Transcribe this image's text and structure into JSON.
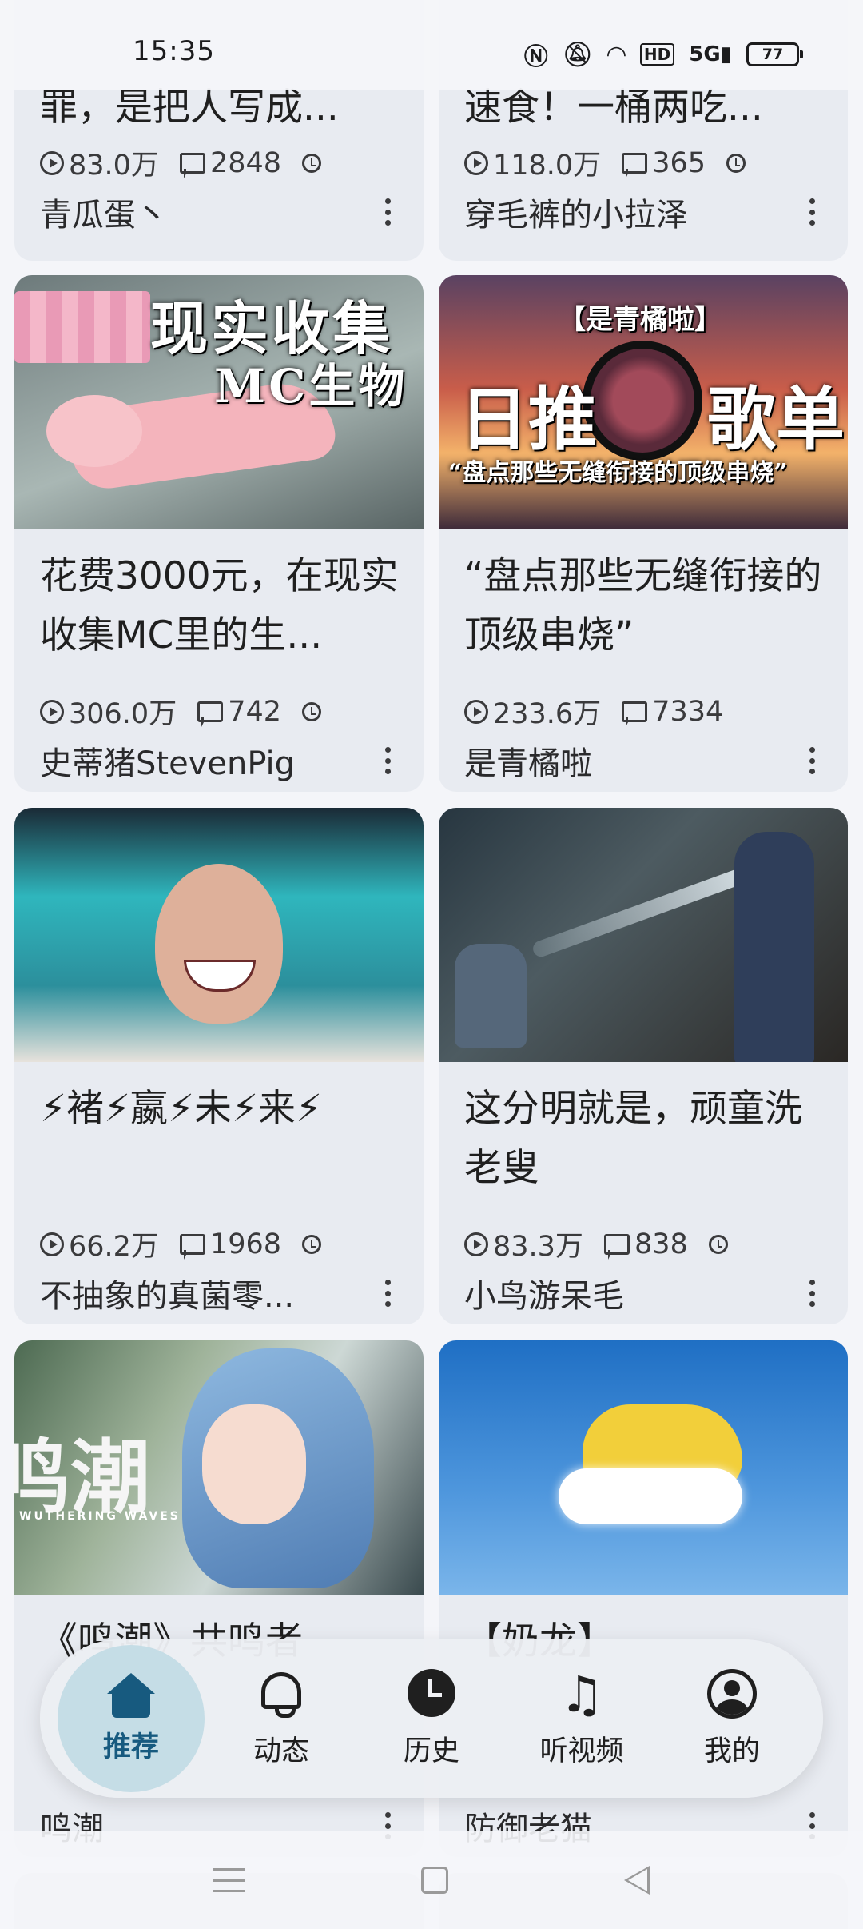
{
  "status_bar": {
    "time": "15:35",
    "icons": [
      "nfc-icon",
      "mute-icon",
      "wifi-icon",
      "hd-icon",
      "5g-signal-icon"
    ],
    "battery": "77"
  },
  "feed": {
    "cards": [
      {
        "title": "罪，是把人写成...",
        "views": "83.0万",
        "comments": "2848",
        "author": "青瓜蛋丶"
      },
      {
        "title": "速食！一桶两吃...",
        "views": "118.0万",
        "comments": "365",
        "author": "穿毛裤的小拉泽"
      },
      {
        "thumb_text": [
          "现实收集",
          "MC生物"
        ],
        "title": "花费3000元，在现实收集MC里的生...",
        "views": "306.0万",
        "comments": "742",
        "author": "史蒂猪StevenPig"
      },
      {
        "thumb_text": [
          "【是青橘啦】",
          "日推",
          "歌单",
          "“盘点那些无缝衔接的顶级串烧”"
        ],
        "title": "“盘点那些无缝衔接的顶级串烧”",
        "views": "233.6万",
        "comments": "7334",
        "author": "是青橘啦"
      },
      {
        "title": "⚡褚⚡嬴⚡未⚡来⚡",
        "views": "66.2万",
        "comments": "1968",
        "author": "不抽象的真菌零..."
      },
      {
        "title": "这分明就是，顽童洗老叟",
        "views": "83.3万",
        "comments": "838",
        "author": "小鸟游呆毛"
      },
      {
        "thumb_text": [
          "鸣潮",
          "WUTHERING WAVES"
        ],
        "title": "《鸣潮》共鸣者",
        "author": "鸣潮"
      },
      {
        "title": "【奶龙】",
        "author": "防御老猫"
      }
    ]
  },
  "bottom_nav": {
    "items": [
      {
        "label": "推荐",
        "icon": "home-icon",
        "active": true
      },
      {
        "label": "动态",
        "icon": "bell-icon",
        "active": false
      },
      {
        "label": "历史",
        "icon": "clock-icon",
        "active": false
      },
      {
        "label": "听视频",
        "icon": "music-note-icon",
        "active": false
      },
      {
        "label": "我的",
        "icon": "user-icon",
        "active": false
      }
    ],
    "active_color": "#175a7f",
    "active_bg": "#c5dde6"
  },
  "system_nav": {
    "buttons": [
      "menu-icon",
      "home-square-icon",
      "back-triangle-icon"
    ]
  }
}
